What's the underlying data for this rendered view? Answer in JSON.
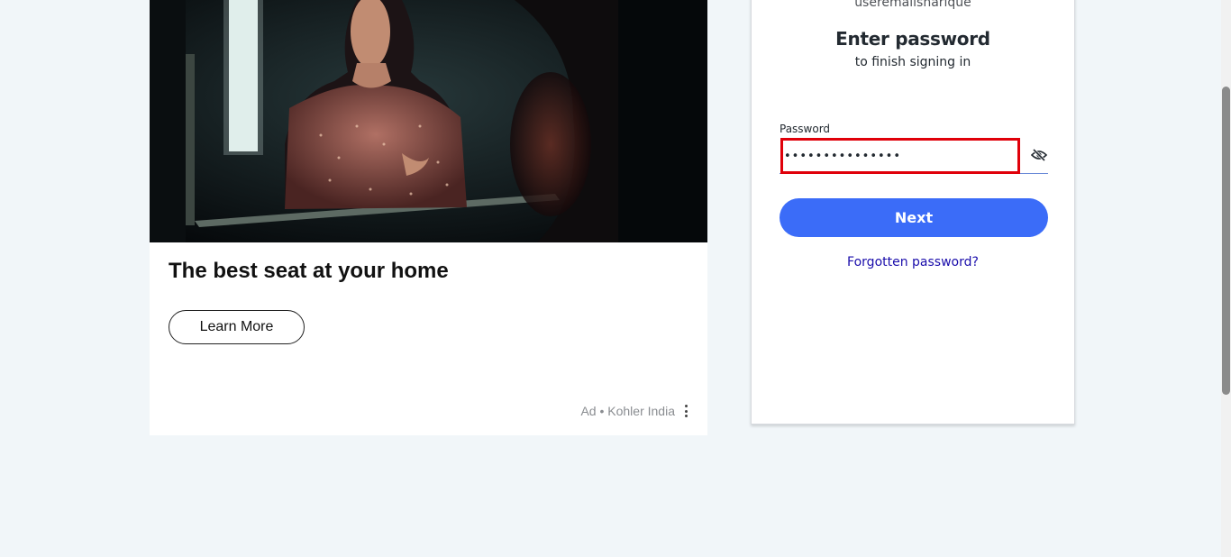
{
  "ad": {
    "image_alt": "Woman in sequined dress looking into a mirror",
    "headline": "The best seat at your home",
    "cta_label": "Learn More",
    "sponsor_text": "Ad • Kohler India",
    "more_options_icon": "kebab-menu-icon"
  },
  "login": {
    "username": "useremailsharique",
    "title": "Enter password",
    "subtitle": "to finish signing in",
    "password_label": "Password",
    "password_value": "•••••••••••••••",
    "toggle_visibility_icon": "eye-slash-icon",
    "next_label": "Next",
    "forgot_label": "Forgotten password?"
  },
  "colors": {
    "page_bg": "#f1f6f9",
    "primary_button": "#3b6cf8",
    "link": "#1a0dab",
    "highlight_border": "#e0000a"
  }
}
